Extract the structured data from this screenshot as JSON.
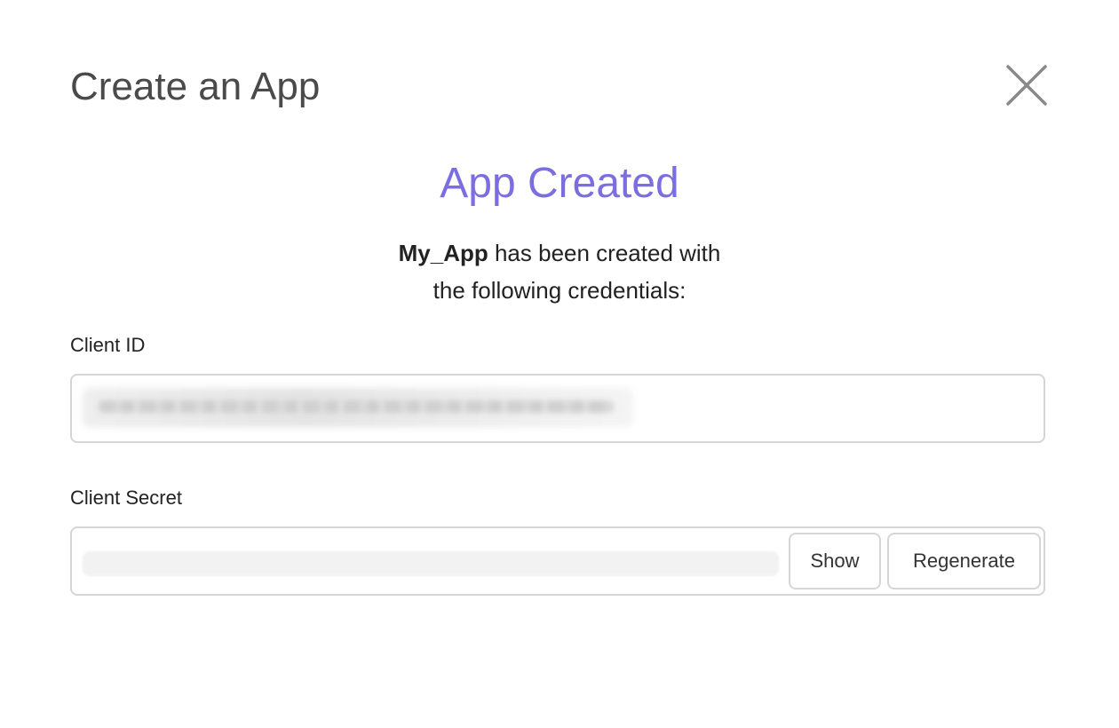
{
  "dialog": {
    "title": "Create an App",
    "close_label": "×"
  },
  "success": {
    "heading": "App Created",
    "app_name": "My_App",
    "message_line1": " has been created with",
    "message_line2": "the following credentials:"
  },
  "client_id": {
    "label": "Client ID",
    "value_redacted": true
  },
  "client_secret": {
    "label": "Client Secret",
    "value_redacted": true,
    "show_label": "Show",
    "regenerate_label": "Regenerate"
  },
  "colors": {
    "accent": "#7b6ee0",
    "title": "#4a4a4a",
    "border": "#d6d6d6",
    "close_icon": "#8a8a8a"
  },
  "icons": {
    "close": "close-icon"
  }
}
